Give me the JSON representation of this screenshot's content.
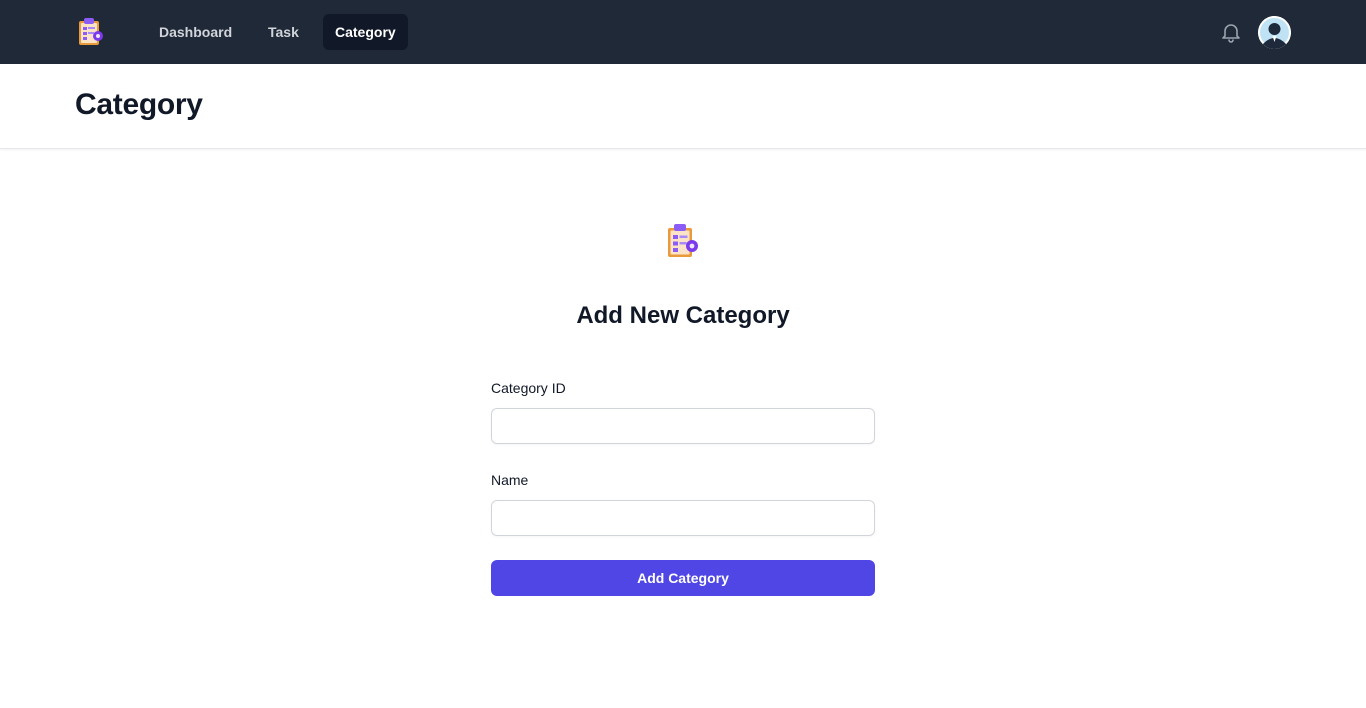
{
  "nav": {
    "logo_icon": "clipboard-gear-icon",
    "links": [
      {
        "label": "Dashboard",
        "active": false
      },
      {
        "label": "Task",
        "active": false
      },
      {
        "label": "Category",
        "active": true
      }
    ],
    "notification_icon": "bell-icon",
    "avatar_icon": "user-avatar-icon"
  },
  "header": {
    "title": "Category"
  },
  "form": {
    "logo_icon": "clipboard-gear-icon",
    "title": "Add New Category",
    "fields": [
      {
        "label": "Category ID",
        "value": "",
        "placeholder": ""
      },
      {
        "label": "Name",
        "value": "",
        "placeholder": ""
      }
    ],
    "submit_label": "Add Category"
  },
  "colors": {
    "nav_background": "#1f2937",
    "nav_active_background": "#111827",
    "primary": "#4f46e5",
    "heading_text": "#111827"
  }
}
